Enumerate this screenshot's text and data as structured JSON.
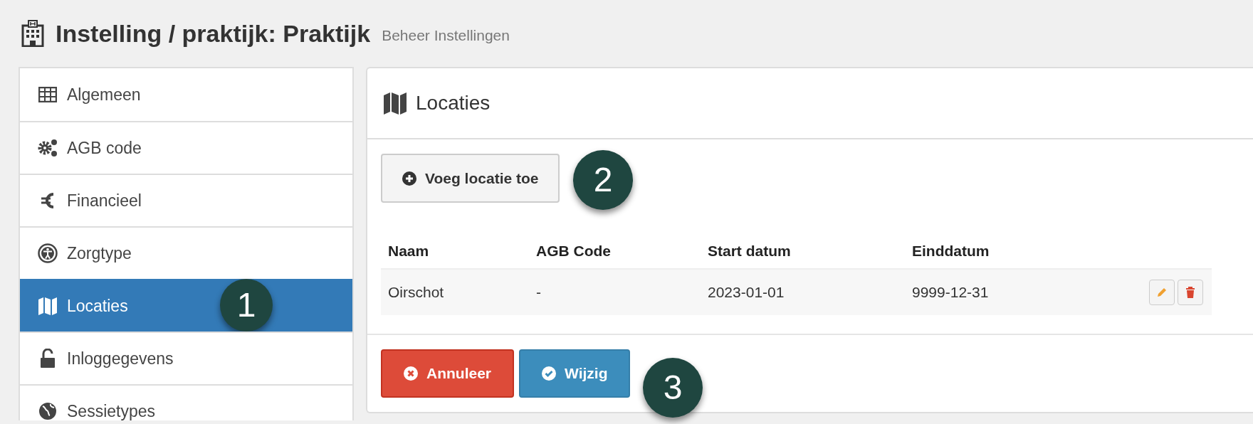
{
  "page_header": {
    "title": "Instelling / praktijk: Praktijk",
    "subtitle": "Beheer Instellingen"
  },
  "sidebar": {
    "items": [
      {
        "label": "Algemeen",
        "selected": false
      },
      {
        "label": "AGB code",
        "selected": false
      },
      {
        "label": "Financieel",
        "selected": false
      },
      {
        "label": "Zorgtype",
        "selected": false
      },
      {
        "label": "Locaties",
        "selected": true
      },
      {
        "label": "Inloggegevens",
        "selected": false
      },
      {
        "label": "Sessietypes",
        "selected": false
      }
    ]
  },
  "panel": {
    "title": "Locaties",
    "add_button": "Voeg locatie toe",
    "table": {
      "columns": [
        "Naam",
        "AGB Code",
        "Start datum",
        "Einddatum"
      ],
      "rows": [
        {
          "cells": [
            "Oirschot",
            "-",
            "2023-01-01",
            "9999-12-31"
          ]
        }
      ]
    },
    "buttons": [
      {
        "label": "Annuleer",
        "kind": "danger"
      },
      {
        "label": "Wijzig",
        "kind": "primary"
      }
    ]
  },
  "callouts": [
    "1",
    "2",
    "3"
  ]
}
